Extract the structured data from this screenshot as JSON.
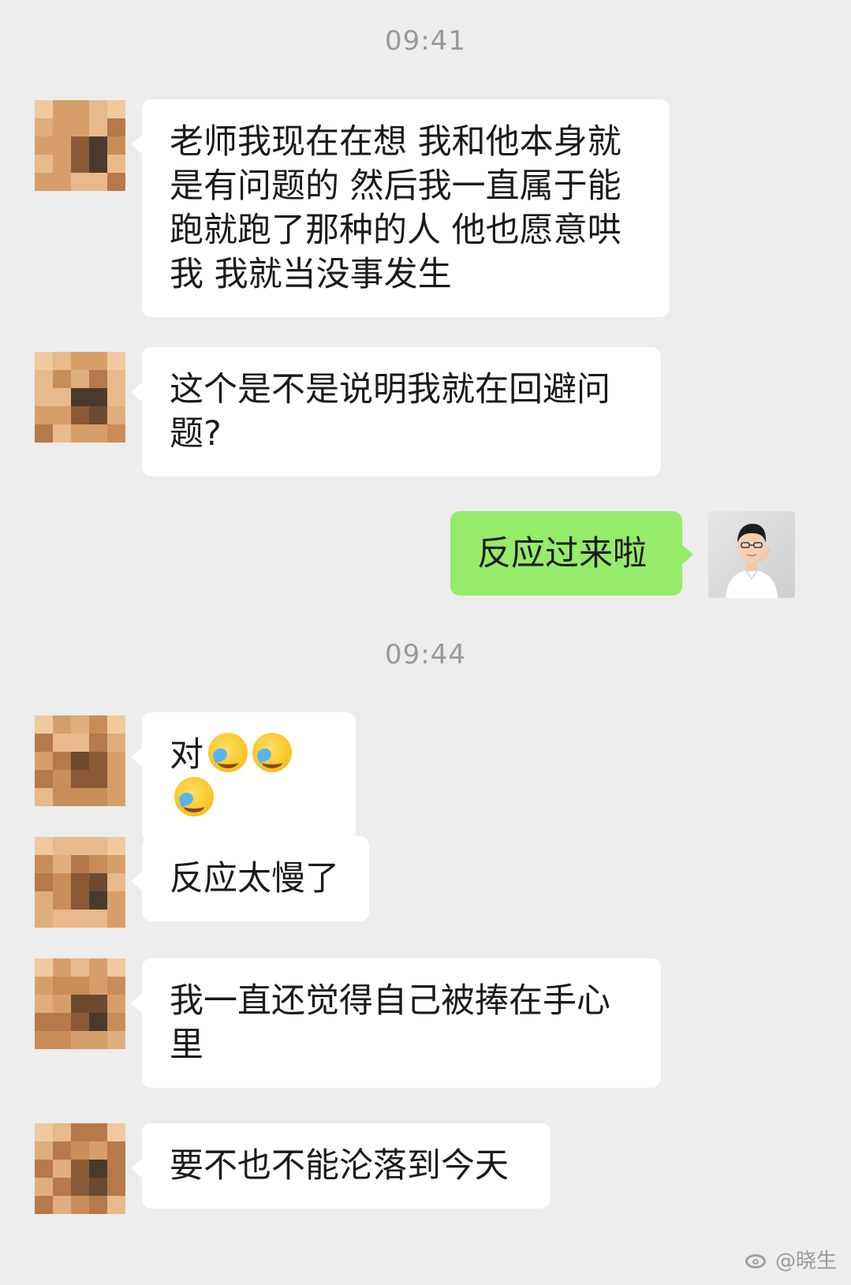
{
  "chat": {
    "timestamps": [
      "09:41",
      "09:44"
    ],
    "messages": [
      {
        "sender": "client",
        "text": "老师我现在在想 我和他本身就是有问题的 然后我一直属于能跑就跑了那种的人 他也愿意哄我 我就当没事发生"
      },
      {
        "sender": "client",
        "text": "这个是不是说明我就在回避问题?"
      },
      {
        "sender": "counselor",
        "text": "反应过来啦"
      },
      {
        "sender": "client",
        "text": "对",
        "emoji": [
          "crying-laughing-face-icon",
          "crying-laughing-face-icon",
          "crying-laughing-face-icon"
        ]
      },
      {
        "sender": "client",
        "text": "反应太慢了"
      },
      {
        "sender": "client",
        "text": "我一直还觉得自己被捧在手心里"
      },
      {
        "sender": "client",
        "text": "要不也不能沦落到今天"
      }
    ]
  },
  "watermark": {
    "text": "@晓生",
    "icon": "weibo-icon"
  },
  "colors": {
    "background": "#ededed",
    "incoming_bubble": "#ffffff",
    "outgoing_bubble": "#95ec69",
    "timestamp_text": "#9a9a9a"
  }
}
